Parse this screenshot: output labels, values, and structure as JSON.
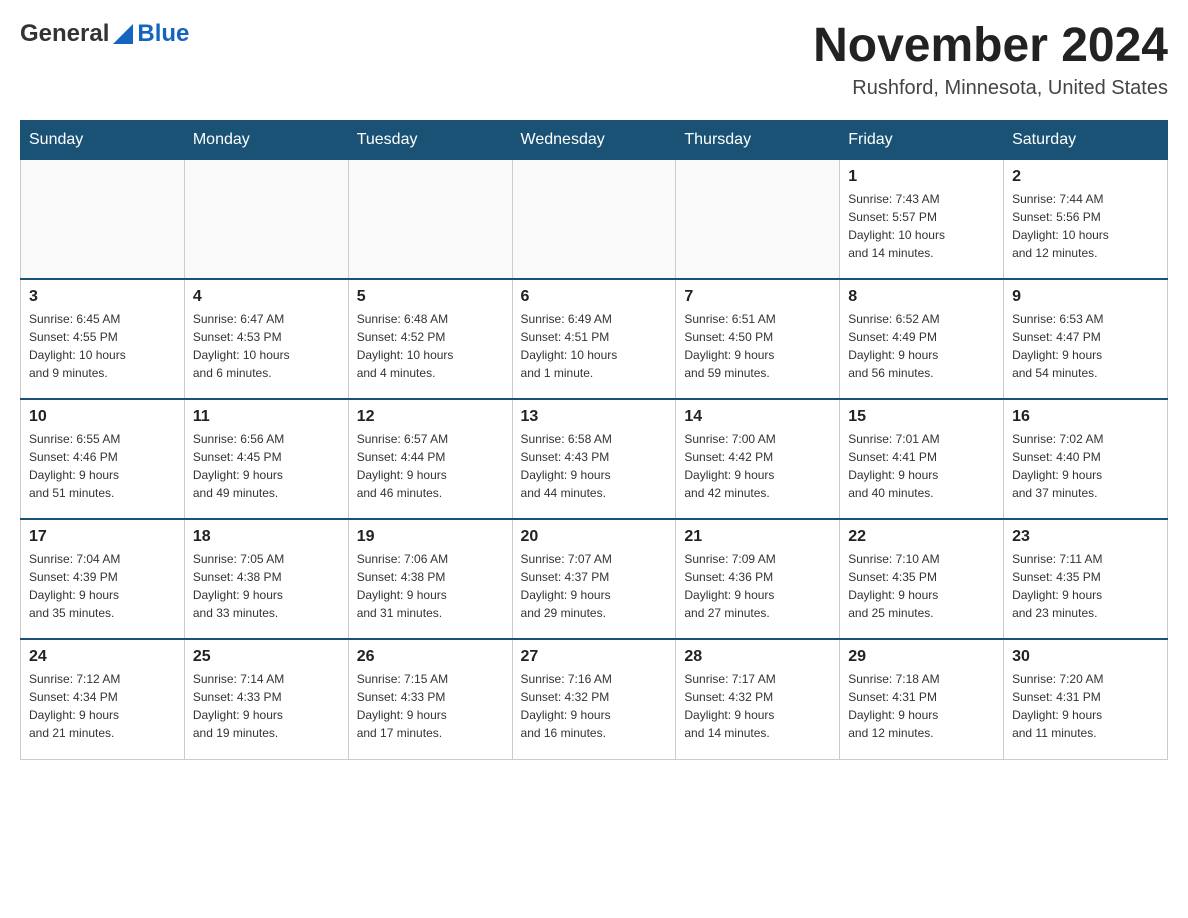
{
  "logo": {
    "general": "General",
    "blue": "Blue"
  },
  "title": "November 2024",
  "location": "Rushford, Minnesota, United States",
  "weekdays": [
    "Sunday",
    "Monday",
    "Tuesday",
    "Wednesday",
    "Thursday",
    "Friday",
    "Saturday"
  ],
  "weeks": [
    [
      {
        "day": "",
        "info": ""
      },
      {
        "day": "",
        "info": ""
      },
      {
        "day": "",
        "info": ""
      },
      {
        "day": "",
        "info": ""
      },
      {
        "day": "",
        "info": ""
      },
      {
        "day": "1",
        "info": "Sunrise: 7:43 AM\nSunset: 5:57 PM\nDaylight: 10 hours\nand 14 minutes."
      },
      {
        "day": "2",
        "info": "Sunrise: 7:44 AM\nSunset: 5:56 PM\nDaylight: 10 hours\nand 12 minutes."
      }
    ],
    [
      {
        "day": "3",
        "info": "Sunrise: 6:45 AM\nSunset: 4:55 PM\nDaylight: 10 hours\nand 9 minutes."
      },
      {
        "day": "4",
        "info": "Sunrise: 6:47 AM\nSunset: 4:53 PM\nDaylight: 10 hours\nand 6 minutes."
      },
      {
        "day": "5",
        "info": "Sunrise: 6:48 AM\nSunset: 4:52 PM\nDaylight: 10 hours\nand 4 minutes."
      },
      {
        "day": "6",
        "info": "Sunrise: 6:49 AM\nSunset: 4:51 PM\nDaylight: 10 hours\nand 1 minute."
      },
      {
        "day": "7",
        "info": "Sunrise: 6:51 AM\nSunset: 4:50 PM\nDaylight: 9 hours\nand 59 minutes."
      },
      {
        "day": "8",
        "info": "Sunrise: 6:52 AM\nSunset: 4:49 PM\nDaylight: 9 hours\nand 56 minutes."
      },
      {
        "day": "9",
        "info": "Sunrise: 6:53 AM\nSunset: 4:47 PM\nDaylight: 9 hours\nand 54 minutes."
      }
    ],
    [
      {
        "day": "10",
        "info": "Sunrise: 6:55 AM\nSunset: 4:46 PM\nDaylight: 9 hours\nand 51 minutes."
      },
      {
        "day": "11",
        "info": "Sunrise: 6:56 AM\nSunset: 4:45 PM\nDaylight: 9 hours\nand 49 minutes."
      },
      {
        "day": "12",
        "info": "Sunrise: 6:57 AM\nSunset: 4:44 PM\nDaylight: 9 hours\nand 46 minutes."
      },
      {
        "day": "13",
        "info": "Sunrise: 6:58 AM\nSunset: 4:43 PM\nDaylight: 9 hours\nand 44 minutes."
      },
      {
        "day": "14",
        "info": "Sunrise: 7:00 AM\nSunset: 4:42 PM\nDaylight: 9 hours\nand 42 minutes."
      },
      {
        "day": "15",
        "info": "Sunrise: 7:01 AM\nSunset: 4:41 PM\nDaylight: 9 hours\nand 40 minutes."
      },
      {
        "day": "16",
        "info": "Sunrise: 7:02 AM\nSunset: 4:40 PM\nDaylight: 9 hours\nand 37 minutes."
      }
    ],
    [
      {
        "day": "17",
        "info": "Sunrise: 7:04 AM\nSunset: 4:39 PM\nDaylight: 9 hours\nand 35 minutes."
      },
      {
        "day": "18",
        "info": "Sunrise: 7:05 AM\nSunset: 4:38 PM\nDaylight: 9 hours\nand 33 minutes."
      },
      {
        "day": "19",
        "info": "Sunrise: 7:06 AM\nSunset: 4:38 PM\nDaylight: 9 hours\nand 31 minutes."
      },
      {
        "day": "20",
        "info": "Sunrise: 7:07 AM\nSunset: 4:37 PM\nDaylight: 9 hours\nand 29 minutes."
      },
      {
        "day": "21",
        "info": "Sunrise: 7:09 AM\nSunset: 4:36 PM\nDaylight: 9 hours\nand 27 minutes."
      },
      {
        "day": "22",
        "info": "Sunrise: 7:10 AM\nSunset: 4:35 PM\nDaylight: 9 hours\nand 25 minutes."
      },
      {
        "day": "23",
        "info": "Sunrise: 7:11 AM\nSunset: 4:35 PM\nDaylight: 9 hours\nand 23 minutes."
      }
    ],
    [
      {
        "day": "24",
        "info": "Sunrise: 7:12 AM\nSunset: 4:34 PM\nDaylight: 9 hours\nand 21 minutes."
      },
      {
        "day": "25",
        "info": "Sunrise: 7:14 AM\nSunset: 4:33 PM\nDaylight: 9 hours\nand 19 minutes."
      },
      {
        "day": "26",
        "info": "Sunrise: 7:15 AM\nSunset: 4:33 PM\nDaylight: 9 hours\nand 17 minutes."
      },
      {
        "day": "27",
        "info": "Sunrise: 7:16 AM\nSunset: 4:32 PM\nDaylight: 9 hours\nand 16 minutes."
      },
      {
        "day": "28",
        "info": "Sunrise: 7:17 AM\nSunset: 4:32 PM\nDaylight: 9 hours\nand 14 minutes."
      },
      {
        "day": "29",
        "info": "Sunrise: 7:18 AM\nSunset: 4:31 PM\nDaylight: 9 hours\nand 12 minutes."
      },
      {
        "day": "30",
        "info": "Sunrise: 7:20 AM\nSunset: 4:31 PM\nDaylight: 9 hours\nand 11 minutes."
      }
    ]
  ]
}
